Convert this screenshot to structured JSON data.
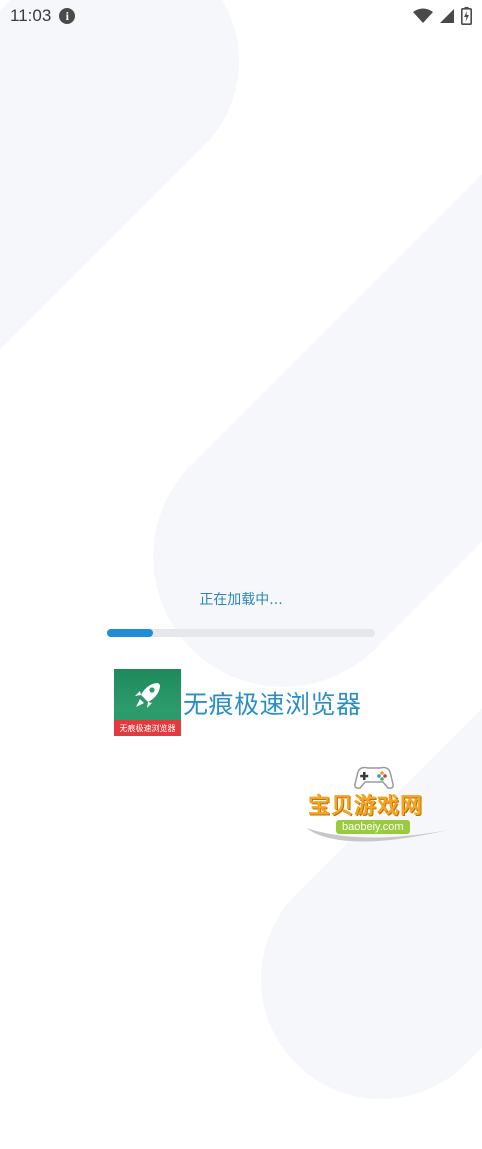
{
  "status_bar": {
    "time": "11:03",
    "info_icon": "info-icon",
    "wifi_icon": "wifi-icon",
    "signal_icon": "signal-icon",
    "battery_icon": "battery-charging-icon"
  },
  "loading": {
    "text": "正在加载中...",
    "progress": 0.17,
    "progress_color": "#1f8ed7"
  },
  "app": {
    "logo_caption": "无痕极速浏览器",
    "name": "无痕极速浏览器",
    "accent_color": "#2a8fc6"
  },
  "watermark": {
    "title": "宝贝游戏网",
    "url": "baobeiy.com"
  }
}
